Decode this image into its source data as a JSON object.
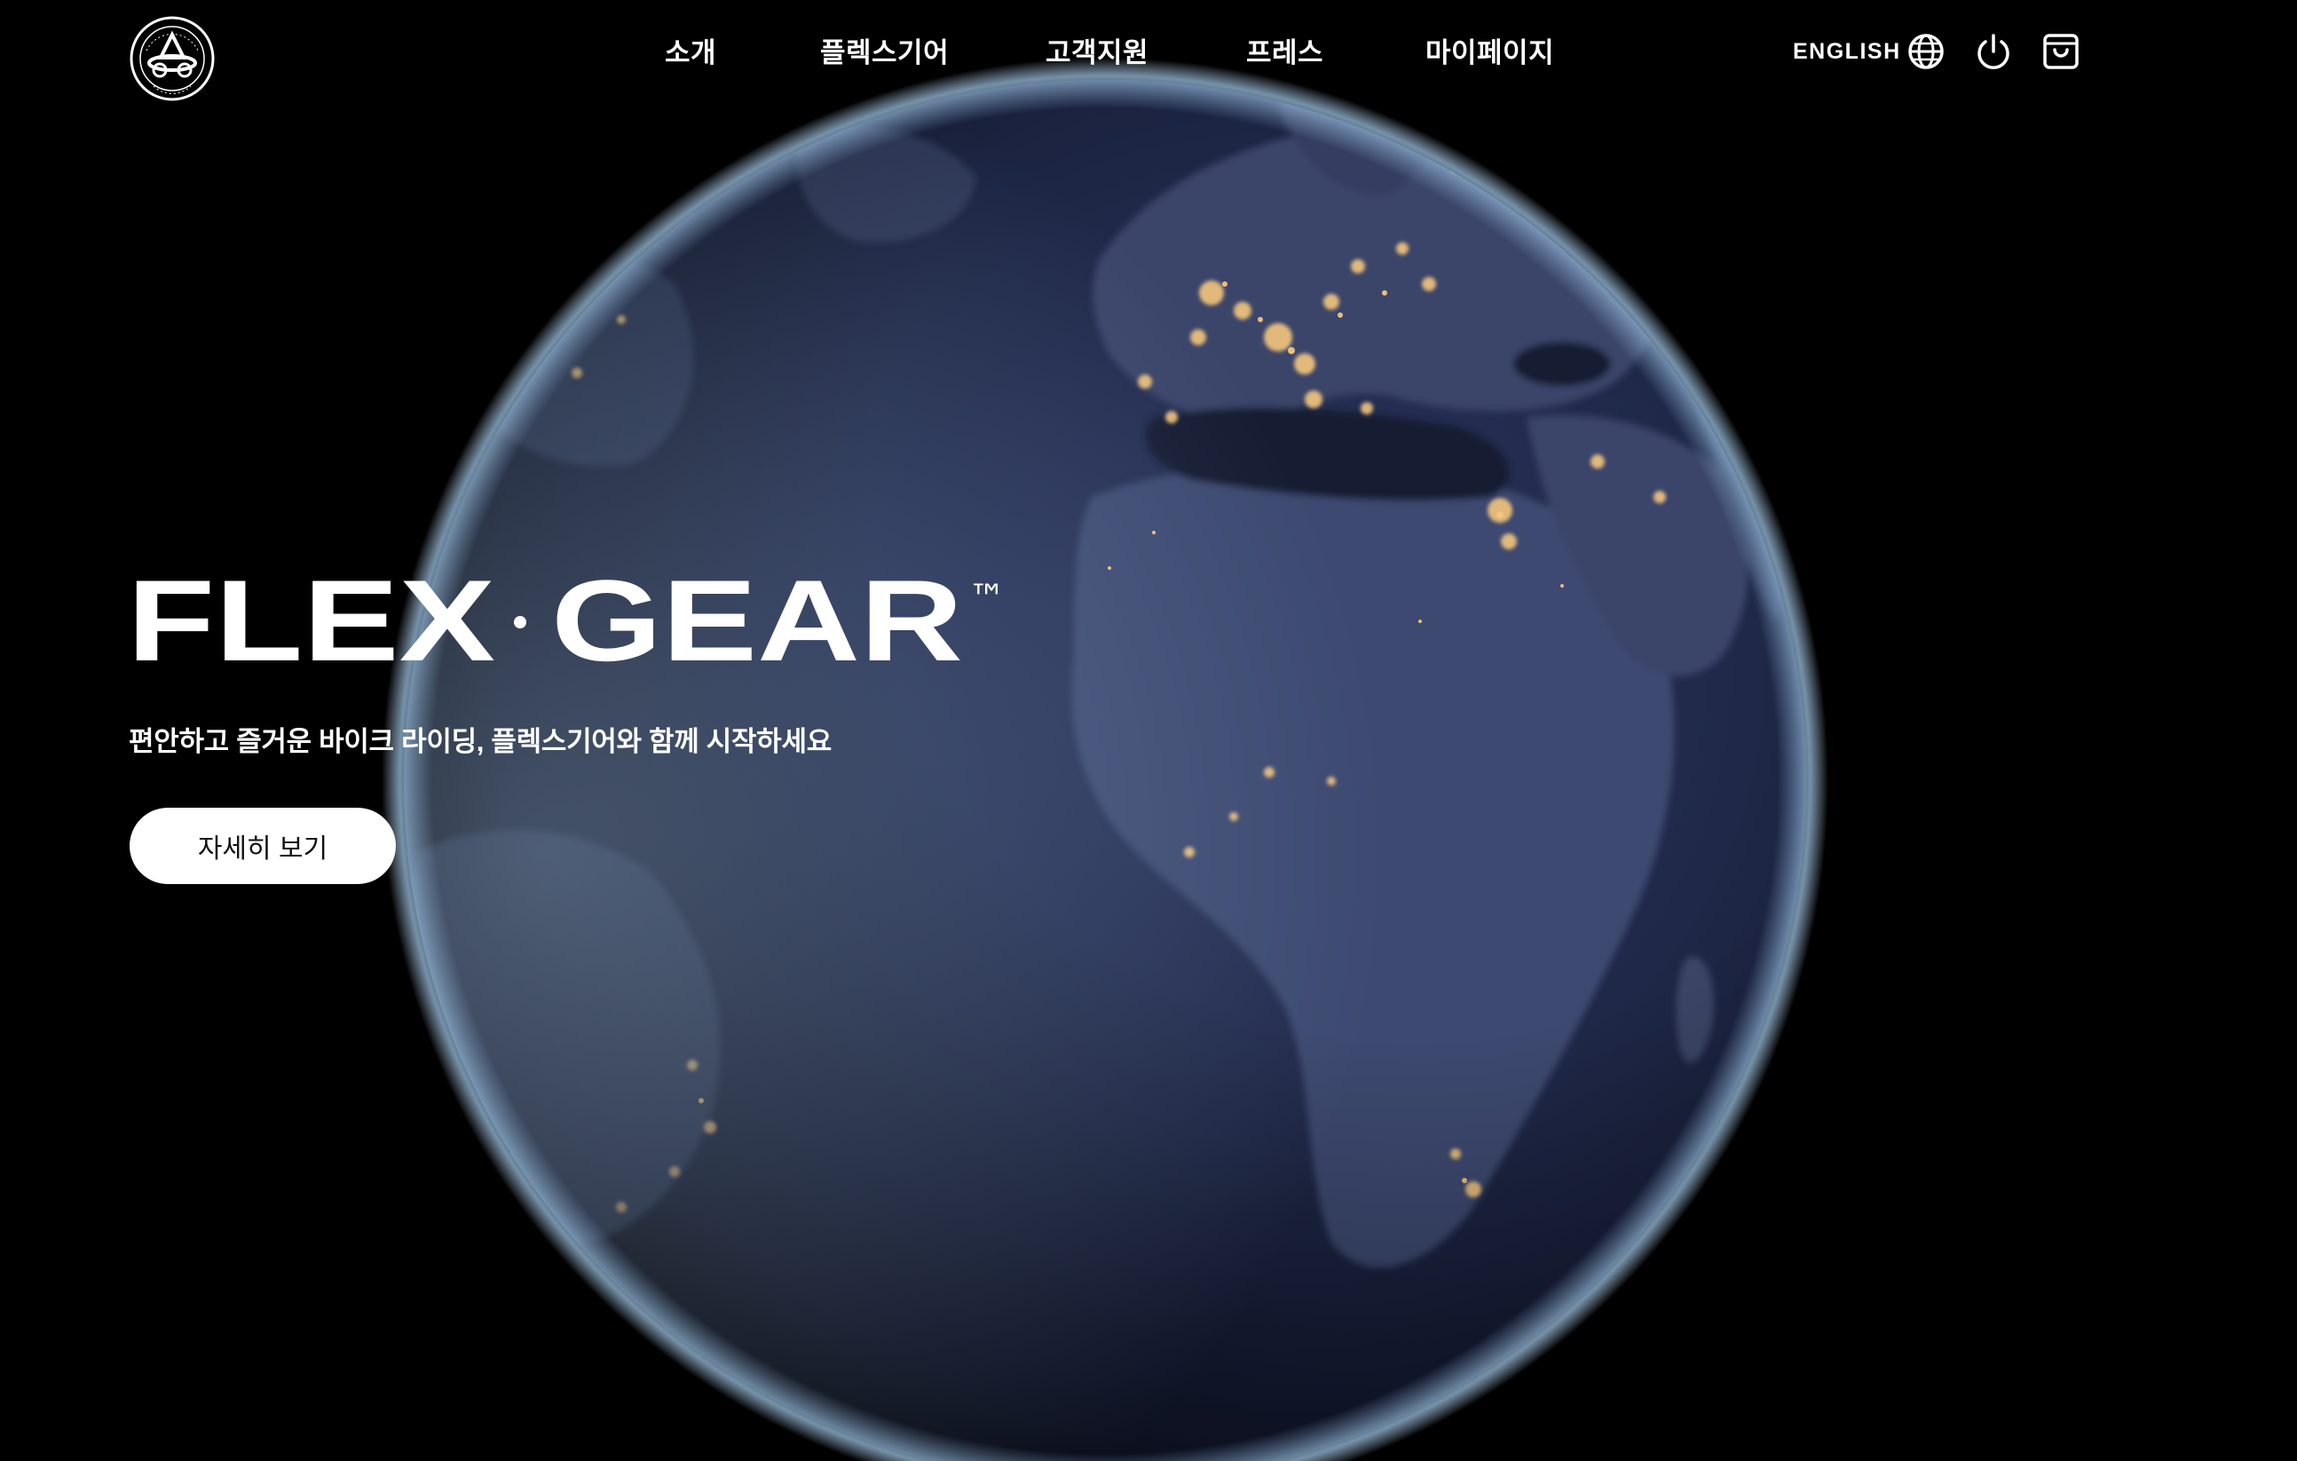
{
  "brand": {
    "title_left": "FLEX",
    "title_right": "GEAR",
    "trademark": "™",
    "logo_icon": "circular-emblem-logo"
  },
  "nav": {
    "items": [
      {
        "label": "소개"
      },
      {
        "label": "플렉스기어"
      },
      {
        "label": "고객지원"
      },
      {
        "label": "프레스"
      },
      {
        "label": "마이페이지"
      }
    ]
  },
  "header_right": {
    "language_label": "ENGLISH",
    "icons": [
      "globe-icon",
      "power-icon",
      "shopping-bag-icon"
    ]
  },
  "hero": {
    "tagline": "편안하고 즐거운 바이크 라이딩, 플렉스기어와 함께 시작하세요",
    "cta_label": "자세히 보기",
    "background": "earth-at-night-globe"
  },
  "colors": {
    "background": "#000000",
    "text": "#ffffff",
    "cta_bg": "#ffffff",
    "cta_text": "#111111",
    "earth_ocean": "#1c2340",
    "earth_land": "#3a4466",
    "city_lights": "#f2c77a",
    "atmosphere": "#8fb4d8"
  }
}
